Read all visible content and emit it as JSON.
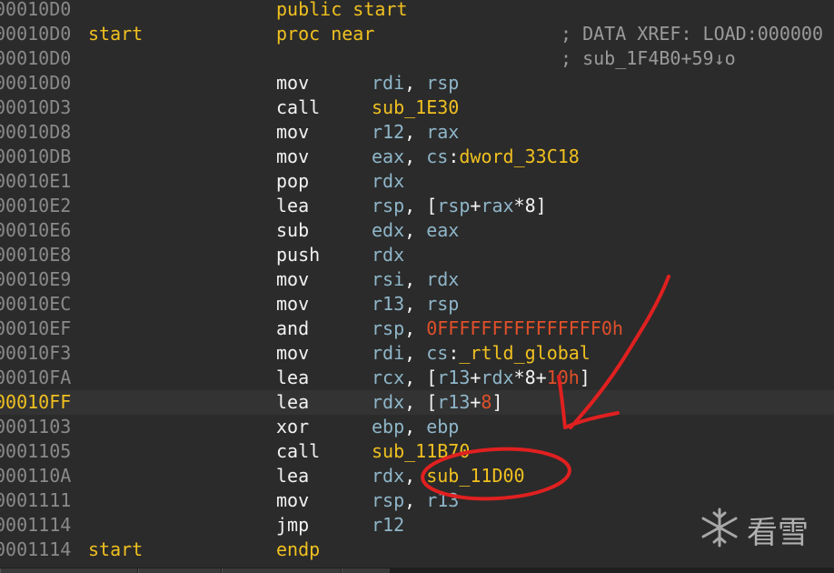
{
  "rows": [
    {
      "addr": "00010D0",
      "label": "",
      "dir": "public start"
    },
    {
      "addr": "00010D0",
      "label": "start",
      "proc": [
        "proc near"
      ],
      "cmt": "; DATA XREF: LOAD:000000"
    },
    {
      "addr": "00010D0",
      "cmt": "; sub_1F4B0+59↓o"
    },
    {
      "addr": "00010D0",
      "mnem": "mov",
      "ops": [
        [
          "reg",
          "rdi"
        ],
        [
          "white",
          ", "
        ],
        [
          "reg",
          "rsp"
        ]
      ]
    },
    {
      "addr": "00010D3",
      "mnem": "call",
      "ops": [
        [
          "sym",
          "sub_1E30"
        ]
      ]
    },
    {
      "addr": "00010D8",
      "mnem": "mov",
      "ops": [
        [
          "reg",
          "r12"
        ],
        [
          "white",
          ", "
        ],
        [
          "reg",
          "rax"
        ]
      ]
    },
    {
      "addr": "00010DB",
      "mnem": "mov",
      "ops": [
        [
          "reg",
          "eax"
        ],
        [
          "white",
          ", "
        ],
        [
          "reg",
          "cs"
        ],
        [
          "white",
          ":"
        ],
        [
          "sym",
          "dword_33C18"
        ]
      ]
    },
    {
      "addr": "00010E1",
      "mnem": "pop",
      "ops": [
        [
          "reg",
          "rdx"
        ]
      ]
    },
    {
      "addr": "00010E2",
      "mnem": "lea",
      "ops": [
        [
          "reg",
          "rsp"
        ],
        [
          "white",
          ", ["
        ],
        [
          "reg",
          "rsp"
        ],
        [
          "white",
          "+"
        ],
        [
          "reg",
          "rax"
        ],
        [
          "white",
          "*8]"
        ]
      ]
    },
    {
      "addr": "00010E6",
      "mnem": "sub",
      "ops": [
        [
          "reg",
          "edx"
        ],
        [
          "white",
          ", "
        ],
        [
          "reg",
          "eax"
        ]
      ]
    },
    {
      "addr": "00010E8",
      "mnem": "push",
      "ops": [
        [
          "reg",
          "rdx"
        ]
      ]
    },
    {
      "addr": "00010E9",
      "mnem": "mov",
      "ops": [
        [
          "reg",
          "rsi"
        ],
        [
          "white",
          ", "
        ],
        [
          "reg",
          "rdx"
        ]
      ]
    },
    {
      "addr": "00010EC",
      "mnem": "mov",
      "ops": [
        [
          "reg",
          "r13"
        ],
        [
          "white",
          ", "
        ],
        [
          "reg",
          "rsp"
        ]
      ]
    },
    {
      "addr": "00010EF",
      "mnem": "and",
      "ops": [
        [
          "reg",
          "rsp"
        ],
        [
          "white",
          ", "
        ],
        [
          "num",
          "0FFFFFFFFFFFFFFF0h"
        ]
      ]
    },
    {
      "addr": "00010F3",
      "mnem": "mov",
      "ops": [
        [
          "reg",
          "rdi"
        ],
        [
          "white",
          ", "
        ],
        [
          "reg",
          "cs"
        ],
        [
          "white",
          ":"
        ],
        [
          "sym",
          "_rtld_global"
        ]
      ]
    },
    {
      "addr": "00010FA",
      "mnem": "lea",
      "ops": [
        [
          "reg",
          "rcx"
        ],
        [
          "white",
          ", ["
        ],
        [
          "reg",
          "r13"
        ],
        [
          "white",
          "+"
        ],
        [
          "reg",
          "rdx"
        ],
        [
          "white",
          "*8+"
        ],
        [
          "num",
          "10h"
        ],
        [
          "white",
          "]"
        ]
      ]
    },
    {
      "addr": "00010FF",
      "current": true,
      "mnem": "lea",
      "ops": [
        [
          "reg",
          "rdx"
        ],
        [
          "white",
          ", ["
        ],
        [
          "reg",
          "r13"
        ],
        [
          "white",
          "+"
        ],
        [
          "num",
          "8"
        ],
        [
          "white",
          "]"
        ]
      ]
    },
    {
      "addr": "0001103",
      "mnem": "xor",
      "ops": [
        [
          "reg",
          "ebp"
        ],
        [
          "white",
          ", "
        ],
        [
          "reg",
          "ebp"
        ]
      ]
    },
    {
      "addr": "0001105",
      "mnem": "call",
      "ops": [
        [
          "sym",
          "sub_11B70"
        ]
      ]
    },
    {
      "addr": "000110A",
      "mnem": "lea",
      "ops": [
        [
          "reg",
          "rdx"
        ],
        [
          "white",
          ", "
        ],
        [
          "sym",
          "sub_11D00"
        ]
      ]
    },
    {
      "addr": "0001111",
      "mnem": "mov",
      "ops": [
        [
          "reg",
          "rsp"
        ],
        [
          "white",
          ", "
        ],
        [
          "reg",
          "r13"
        ]
      ]
    },
    {
      "addr": "0001114",
      "mnem": "jmp",
      "ops": [
        [
          "reg",
          "r12"
        ]
      ]
    },
    {
      "addr": "0001114",
      "label": "start",
      "dir": "endp"
    }
  ],
  "watermark": {
    "text": "看雪"
  },
  "colors": {
    "background": "#2b2b2b",
    "address": "#8a8a8a",
    "symbol": "#f0c020",
    "register": "#8fb6c9",
    "number": "#e0502a",
    "annotation": "#e02020"
  }
}
